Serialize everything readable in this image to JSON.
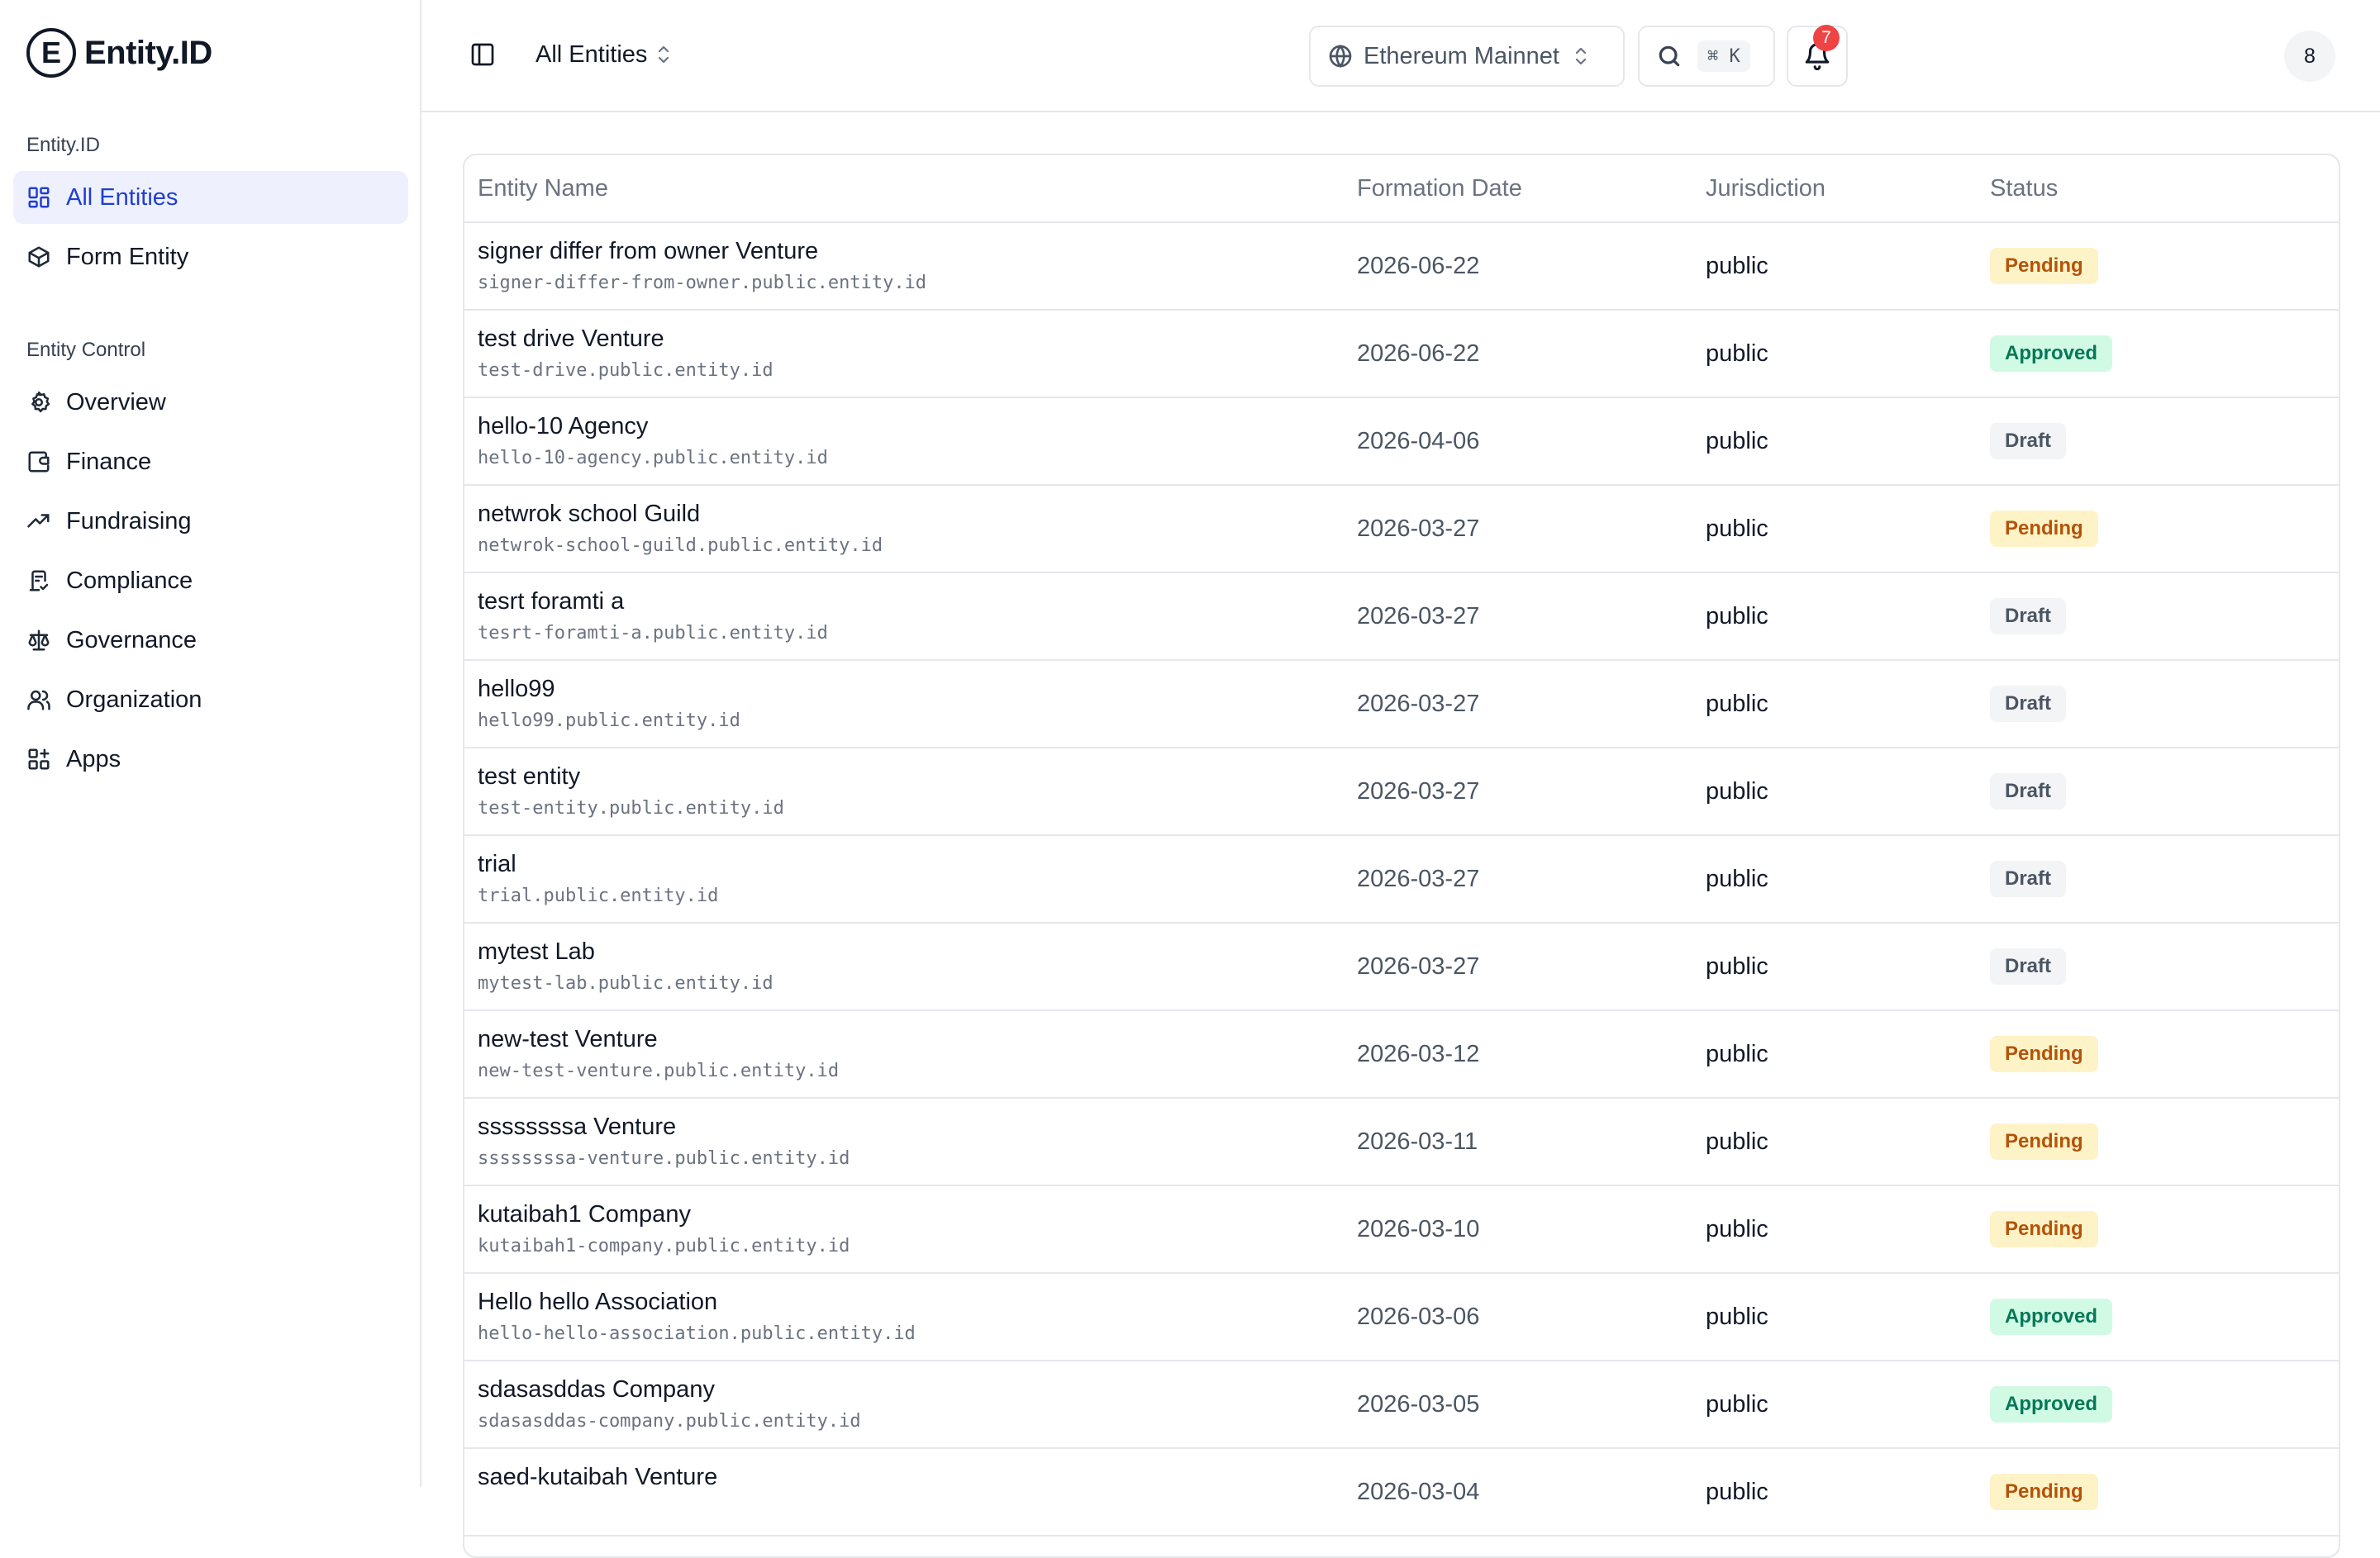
{
  "brand": {
    "logo_letter": "E",
    "name": "Entity.ID"
  },
  "sidebar": {
    "group1": {
      "label": "Entity.ID",
      "items": [
        {
          "label": "All Entities",
          "icon": "grid-icon",
          "active": true
        },
        {
          "label": "Form Entity",
          "icon": "box-icon",
          "active": false
        }
      ]
    },
    "group2": {
      "label": "Entity Control",
      "items": [
        {
          "label": "Overview",
          "icon": "gear-icon"
        },
        {
          "label": "Finance",
          "icon": "wallet-icon"
        },
        {
          "label": "Fundraising",
          "icon": "trending-up-icon"
        },
        {
          "label": "Compliance",
          "icon": "document-check-icon"
        },
        {
          "label": "Governance",
          "icon": "scale-icon"
        },
        {
          "label": "Organization",
          "icon": "users-icon"
        },
        {
          "label": "Apps",
          "icon": "apps-icon"
        }
      ]
    }
  },
  "header": {
    "scope_label": "All Entities",
    "network_label": "Ethereum Mainnet",
    "search_shortcut": "⌘ K",
    "notifications_count": "7",
    "avatar_text": "8"
  },
  "table": {
    "headers": {
      "name": "Entity Name",
      "date": "Formation Date",
      "jurisdiction": "Jurisdiction",
      "status": "Status"
    },
    "rows": [
      {
        "name": "signer differ from owner Venture",
        "domain": "signer-differ-from-owner.public.entity.id",
        "date": "2026-06-22",
        "jurisdiction": "public",
        "status": "Pending",
        "status_kind": "pending"
      },
      {
        "name": "test drive Venture",
        "domain": "test-drive.public.entity.id",
        "date": "2026-06-22",
        "jurisdiction": "public",
        "status": "Approved",
        "status_kind": "approved"
      },
      {
        "name": "hello-10 Agency",
        "domain": "hello-10-agency.public.entity.id",
        "date": "2026-04-06",
        "jurisdiction": "public",
        "status": "Draft",
        "status_kind": "draft"
      },
      {
        "name": "netwrok school Guild",
        "domain": "netwrok-school-guild.public.entity.id",
        "date": "2026-03-27",
        "jurisdiction": "public",
        "status": "Pending",
        "status_kind": "pending"
      },
      {
        "name": "tesrt foramti a",
        "domain": "tesrt-foramti-a.public.entity.id",
        "date": "2026-03-27",
        "jurisdiction": "public",
        "status": "Draft",
        "status_kind": "draft"
      },
      {
        "name": "hello99",
        "domain": "hello99.public.entity.id",
        "date": "2026-03-27",
        "jurisdiction": "public",
        "status": "Draft",
        "status_kind": "draft"
      },
      {
        "name": "test entity",
        "domain": "test-entity.public.entity.id",
        "date": "2026-03-27",
        "jurisdiction": "public",
        "status": "Draft",
        "status_kind": "draft"
      },
      {
        "name": "trial",
        "domain": "trial.public.entity.id",
        "date": "2026-03-27",
        "jurisdiction": "public",
        "status": "Draft",
        "status_kind": "draft"
      },
      {
        "name": "mytest Lab",
        "domain": "mytest-lab.public.entity.id",
        "date": "2026-03-27",
        "jurisdiction": "public",
        "status": "Draft",
        "status_kind": "draft"
      },
      {
        "name": "new-test Venture",
        "domain": "new-test-venture.public.entity.id",
        "date": "2026-03-12",
        "jurisdiction": "public",
        "status": "Pending",
        "status_kind": "pending"
      },
      {
        "name": "ssssssssa Venture",
        "domain": "ssssssssa-venture.public.entity.id",
        "date": "2026-03-11",
        "jurisdiction": "public",
        "status": "Pending",
        "status_kind": "pending"
      },
      {
        "name": "kutaibah1 Company",
        "domain": "kutaibah1-company.public.entity.id",
        "date": "2026-03-10",
        "jurisdiction": "public",
        "status": "Pending",
        "status_kind": "pending"
      },
      {
        "name": "Hello hello Association",
        "domain": "hello-hello-association.public.entity.id",
        "date": "2026-03-06",
        "jurisdiction": "public",
        "status": "Approved",
        "status_kind": "approved"
      },
      {
        "name": "sdasasddas Company",
        "domain": "sdasasddas-company.public.entity.id",
        "date": "2026-03-05",
        "jurisdiction": "public",
        "status": "Approved",
        "status_kind": "approved"
      },
      {
        "name": "saed-kutaibah Venture",
        "domain": "",
        "date": "2026-03-04",
        "jurisdiction": "public",
        "status": "Pending",
        "status_kind": "pending"
      }
    ]
  }
}
